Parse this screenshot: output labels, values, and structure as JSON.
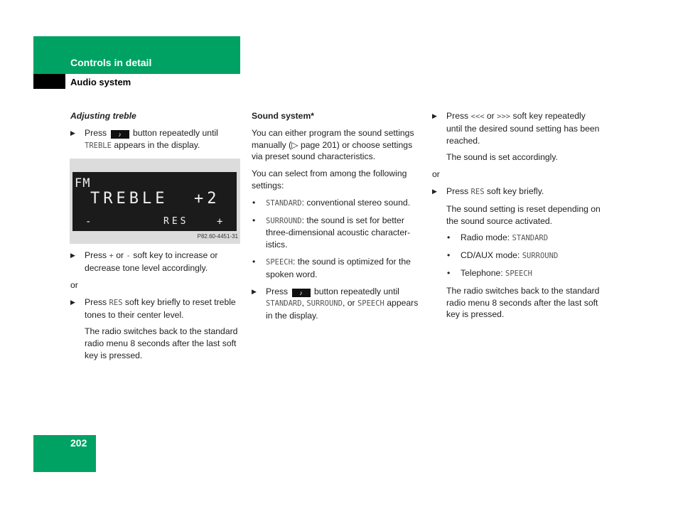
{
  "header": {
    "section": "Controls in detail",
    "subsection": "Audio system"
  },
  "page_number": "202",
  "col1": {
    "heading": "Adjusting treble",
    "step1": {
      "pre": "Press",
      "icon": "sound-key-icon",
      "post": "button repeatedly until",
      "mono": "TREBLE",
      "tail": "appears in the display."
    },
    "display": {
      "line1": "FM",
      "line2": "TREBLE  +2",
      "softkey_left": "-",
      "softkey_mid": "RES",
      "softkey_right": "+",
      "caption": "P82.60-4451-31"
    },
    "step2": {
      "pre": "Press",
      "plus": "+",
      "or": "or",
      "minus": "-",
      "post": "soft key to increase or decrease tone level accordingly."
    },
    "or": "or",
    "step3": {
      "pre": "Press",
      "mono": "RES",
      "post": "soft key briefly to reset treble tones to their center level."
    },
    "note": "The radio switches back to the standard radio menu 8 seconds after the last soft key is pressed."
  },
  "col2": {
    "heading": "Sound system*",
    "para1": "You can either program the sound settings manually (▷ page 201) or choose settings via preset sound characteristics.",
    "para2": "You can select from among the following settings:",
    "bullets": [
      {
        "mono": "STANDARD",
        "text": ": conventional stereo sound."
      },
      {
        "mono": "SURROUND",
        "text": ": the sound is set for better three-dimensional acoustic character-istics."
      },
      {
        "mono": "SPEECH",
        "text": ": the sound is optimized for the spoken word."
      }
    ],
    "step": {
      "pre": "Press",
      "post": "button repeatedly until",
      "m1": "STANDARD",
      "c1": ",",
      "m2": "SURROUND",
      "c2": ", or",
      "m3": "SPEECH",
      "tail": "appears in the display."
    }
  },
  "col3": {
    "step1": {
      "pre": "Press",
      "left": "<<<",
      "or": "or",
      "right": ">>>",
      "post": "soft key repeatedly until the desired sound setting has been reached."
    },
    "note1": "The sound is set accordingly.",
    "or": "or",
    "step2": {
      "pre": "Press",
      "mono": "RES",
      "post": "soft key briefly."
    },
    "note2": "The sound setting is reset depending on the sound source activated.",
    "bullets": [
      {
        "label": "Radio mode: ",
        "mono": "STANDARD"
      },
      {
        "label": "CD/AUX mode: ",
        "mono": "SURROUND"
      },
      {
        "label": "Telephone: ",
        "mono": "SPEECH"
      }
    ],
    "note3": "The radio switches back to the standard radio menu 8 seconds after the last soft key is pressed."
  },
  "glyphs": {
    "triangle": "▶",
    "dot": "•",
    "key": "♪"
  }
}
